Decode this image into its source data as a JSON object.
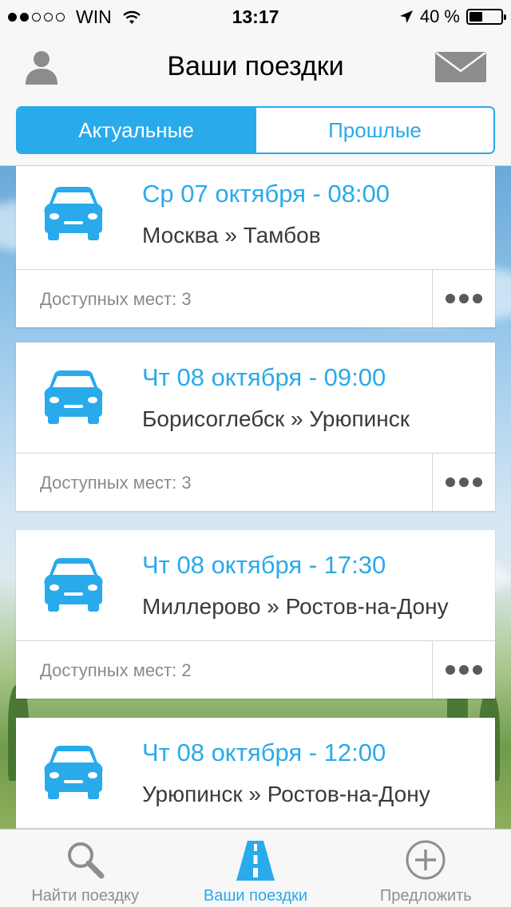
{
  "status_bar": {
    "carrier": "WIN",
    "time": "13:17",
    "battery": "40 %",
    "battery_level": 0.4,
    "signal_bars": 2
  },
  "header": {
    "title": "Ваши поездки",
    "left_icon": "profile-icon",
    "right_icon": "mail-icon"
  },
  "segments": {
    "active_label": "Актуальные",
    "past_label": "Прошлые"
  },
  "trips": [
    {
      "date": "Ср 07 октября - 08:00",
      "route": "Москва » Тамбов",
      "seats": "Доступных мест: 3"
    },
    {
      "date": "Чт 08 октября - 09:00",
      "route": "Борисоглебск » Урюпинск",
      "seats": "Доступных мест: 3"
    },
    {
      "date": "Чт 08 октября - 17:30",
      "route": "Миллерово » Ростов-на-Дону",
      "seats": "Доступных мест: 2"
    },
    {
      "date": "Чт 08 октября - 12:00",
      "route": "Урюпинск » Ростов-на-Дону",
      "seats": ""
    }
  ],
  "tabbar": {
    "find_label": "Найти поездку",
    "mine_label": "Ваши поездки",
    "offer_label": "Предложить"
  },
  "colors": {
    "accent": "#29aaeb",
    "text": "#3a3a3a",
    "muted": "#8a8a8a"
  }
}
